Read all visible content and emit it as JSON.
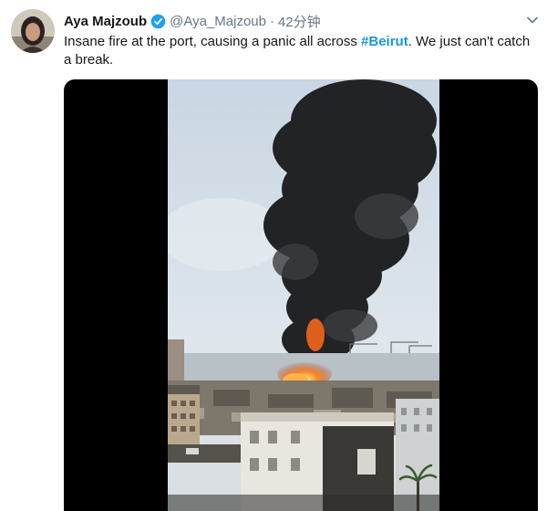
{
  "tweet": {
    "author": {
      "display_name": "Aya Majzoub",
      "handle": "@Aya_Majzoub",
      "verified": true,
      "avatar_icon": "avatar-photo"
    },
    "separator": "·",
    "time": "42分钟",
    "text_before": "Insane fire at the port, causing a panic all across ",
    "hashtag": "#Beirut",
    "text_after": ". We just can't catch a break.",
    "menu_icon": "chevron-down-icon",
    "media": {
      "type": "video",
      "subject": "smoke-and-fire-photo"
    }
  },
  "colors": {
    "link": "#1b95e0",
    "verified": "#1da1f2",
    "muted": "#657786",
    "media_bg": "#000000"
  }
}
